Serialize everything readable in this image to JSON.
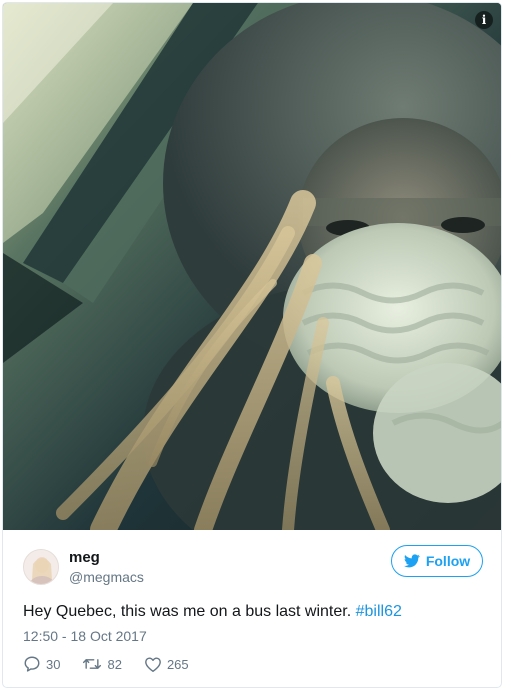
{
  "tweet": {
    "media": {
      "info_icon": "info-icon",
      "info_label": "i"
    },
    "author": {
      "name": "meg",
      "handle": "@megmacs",
      "avatar_icon": "avatar"
    },
    "follow": {
      "label": "Follow",
      "icon": "twitter-bird-icon",
      "color": "#1da1f2"
    },
    "text_main": "Hey Quebec, this was me on a bus last winter. ",
    "hashtag": "#bill62",
    "timestamp": "12:50 - 18 Oct 2017",
    "actions": {
      "replies": "30",
      "retweets": "82",
      "likes": "265"
    },
    "colors": {
      "text": "#14171a",
      "muted": "#657786",
      "link": "#1b95e0"
    }
  }
}
